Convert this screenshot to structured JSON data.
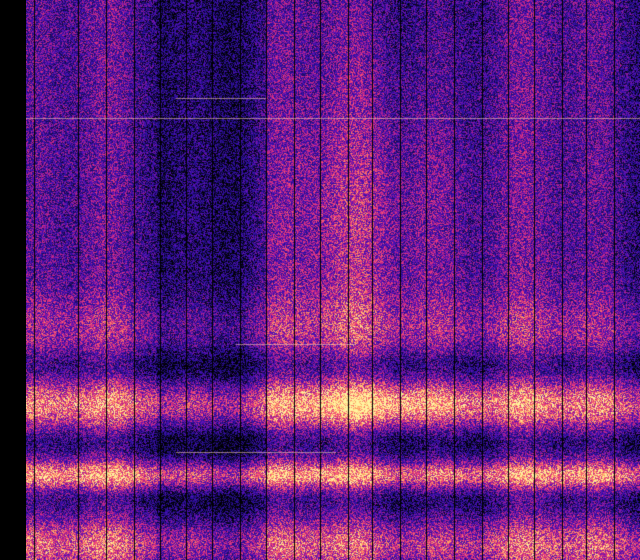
{
  "view": {
    "type": "spectrogram",
    "colormap": "magma",
    "colormap_stops": [
      "#000004",
      "#1a0c5c",
      "#2a0fa0",
      "#5a11b8",
      "#b0208c",
      "#f0407a",
      "#ffa060",
      "#fff5a0"
    ],
    "background": "#000000",
    "left_margin_color": "#000000",
    "gap_line_color": "#000000"
  },
  "chart_data": {
    "type": "heatmap",
    "title": "",
    "xlabel": "",
    "ylabel": "",
    "description_bands": [
      {
        "level": "high",
        "region": "bottom"
      },
      {
        "level": "high",
        "region": "lower-middle"
      },
      {
        "level": "medium",
        "region": "middle"
      },
      {
        "level": "low",
        "region": "upper"
      }
    ]
  }
}
